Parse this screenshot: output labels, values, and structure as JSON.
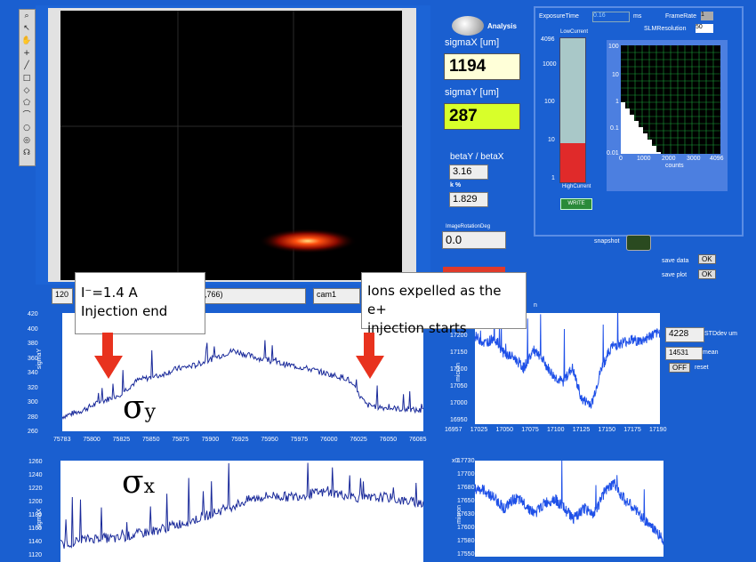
{
  "toolbar": {
    "tools": [
      "zoom-icon",
      "pointer-icon",
      "pan-icon",
      "crosshair-icon",
      "line-icon",
      "rectangle-icon",
      "diamond-icon",
      "polygon-icon",
      "freehand-icon",
      "ellipse-icon",
      "annulus-icon",
      "lasso-icon"
    ]
  },
  "analysis": {
    "label": "Analysis",
    "sigmaX_label": "sigmaX [um]",
    "sigmaX_value": "1194",
    "sigmaY_label": "sigmaY [um]",
    "sigmaY_value": "287",
    "beta_label": "betaY / betaX",
    "beta_value": "3.16",
    "k_label": "k %",
    "k_value": "1.829",
    "rotation_label": "ImageRotationDeg",
    "rotation_value": "0.0"
  },
  "camera": {
    "coord_partial_left": "120",
    "coord_partial_right": ",766)",
    "camera_select": "cam1"
  },
  "settings": {
    "exposure_label": "ExposureTime",
    "exposure_value": "0.16",
    "exposure_unit": "ms",
    "framerate_label": "FrameRate",
    "framerate_value": "1",
    "slm_label": "SLMResolution",
    "slm_value": "50",
    "lowcurrent_label": "LowCurrent",
    "highcurrent_label": "HighCurrent",
    "write_label": "WRITE",
    "counts_label": "counts",
    "gauge_ticks": [
      "4096",
      "1000",
      "100",
      "10",
      "1"
    ],
    "gauge_level": 0.27
  },
  "snapshot": {
    "label": "snapshot",
    "save_data_label": "save data",
    "save_plot_label": "save plot",
    "ok_label": "OK"
  },
  "stats": {
    "stddev_value": "4228",
    "stddev_label": "STDdev um",
    "mean_value": "14531",
    "mean_label": "mean",
    "off_label": "OFF",
    "reset_label": "reset"
  },
  "annotations": {
    "left_line1": "I⁻=1.4 A",
    "left_line2": "Injection end",
    "right_line1": "Ions expelled as the e+",
    "right_line2": "injection starts",
    "sigma_y": "σ",
    "sigma_y_sub": "y",
    "sigma_x": "σ",
    "sigma_x_sub": "x",
    "partial_label": "n"
  },
  "chart_data": [
    {
      "type": "line",
      "id": "sigmaY-time",
      "ylabel": "sigmaY",
      "ylim": [
        260,
        420
      ],
      "yticks": [
        "420",
        "400",
        "380",
        "360",
        "340",
        "320",
        "300",
        "280",
        "260"
      ],
      "xticks": [
        "75783",
        "75800",
        "75825",
        "75850",
        "75875",
        "75900",
        "75925",
        "75950",
        "75975",
        "76000",
        "76025",
        "76050",
        "76085"
      ],
      "x": [
        75783,
        75790,
        75800,
        75810,
        75815,
        75825,
        75835,
        75850,
        75875,
        75900,
        75925,
        75950,
        75975,
        76000,
        76025,
        76035,
        76040,
        76050,
        76065,
        76085
      ],
      "values": [
        280,
        288,
        300,
        310,
        330,
        335,
        345,
        350,
        360,
        370,
        362,
        355,
        350,
        345,
        338,
        332,
        296,
        292,
        290,
        288
      ]
    },
    {
      "type": "line",
      "id": "sigmaX-time",
      "ylabel": "sigmaX",
      "ylim": [
        1120,
        1260
      ],
      "yticks": [
        "1260",
        "1240",
        "1220",
        "1200",
        "1180",
        "1160",
        "1140",
        "1120"
      ],
      "values": [
        1140,
        1145,
        1150,
        1148,
        1155,
        1160,
        1168,
        1175,
        1185,
        1195,
        1205,
        1210,
        1208,
        1212,
        1215,
        1210,
        1205,
        1208,
        1202,
        1200
      ]
    },
    {
      "type": "line",
      "id": "pos-time-top",
      "ylabel": "micron",
      "ylim": [
        16950,
        17250
      ],
      "yticks": [
        "17250",
        "17200",
        "17150",
        "17100",
        "17050",
        "17000",
        "16950"
      ],
      "xticks": [
        "16957",
        "17025",
        "17050",
        "17075",
        "17100",
        "17125",
        "17150",
        "17175",
        "17190"
      ],
      "values": [
        17190,
        17170,
        17185,
        17140,
        17130,
        17100,
        17150,
        17120,
        17080,
        17060,
        17100,
        17010,
        17000,
        17100,
        17160,
        17170,
        17180,
        17175,
        17190,
        17200
      ]
    },
    {
      "type": "line",
      "id": "pos-time-bottom",
      "ylabel": "micron",
      "yaxis_prefix": "x0",
      "ylim": [
        17550,
        17730
      ],
      "yticks": [
        "17730",
        "17700",
        "17680",
        "17650",
        "17630",
        "17600",
        "17580",
        "17550"
      ],
      "values": [
        17680,
        17675,
        17660,
        17640,
        17660,
        17650,
        17630,
        17650,
        17660,
        17640,
        17620,
        17640,
        17630,
        17670,
        17690,
        17660,
        17640,
        17620,
        17600,
        17580
      ]
    },
    {
      "type": "heatmap",
      "id": "lut-plot",
      "xlabel": "counts",
      "xticks": [
        "0",
        "1000",
        "2000",
        "3000",
        "4096"
      ],
      "yticks": [
        "100",
        "10",
        "1",
        "0.1",
        "0.01"
      ]
    }
  ]
}
